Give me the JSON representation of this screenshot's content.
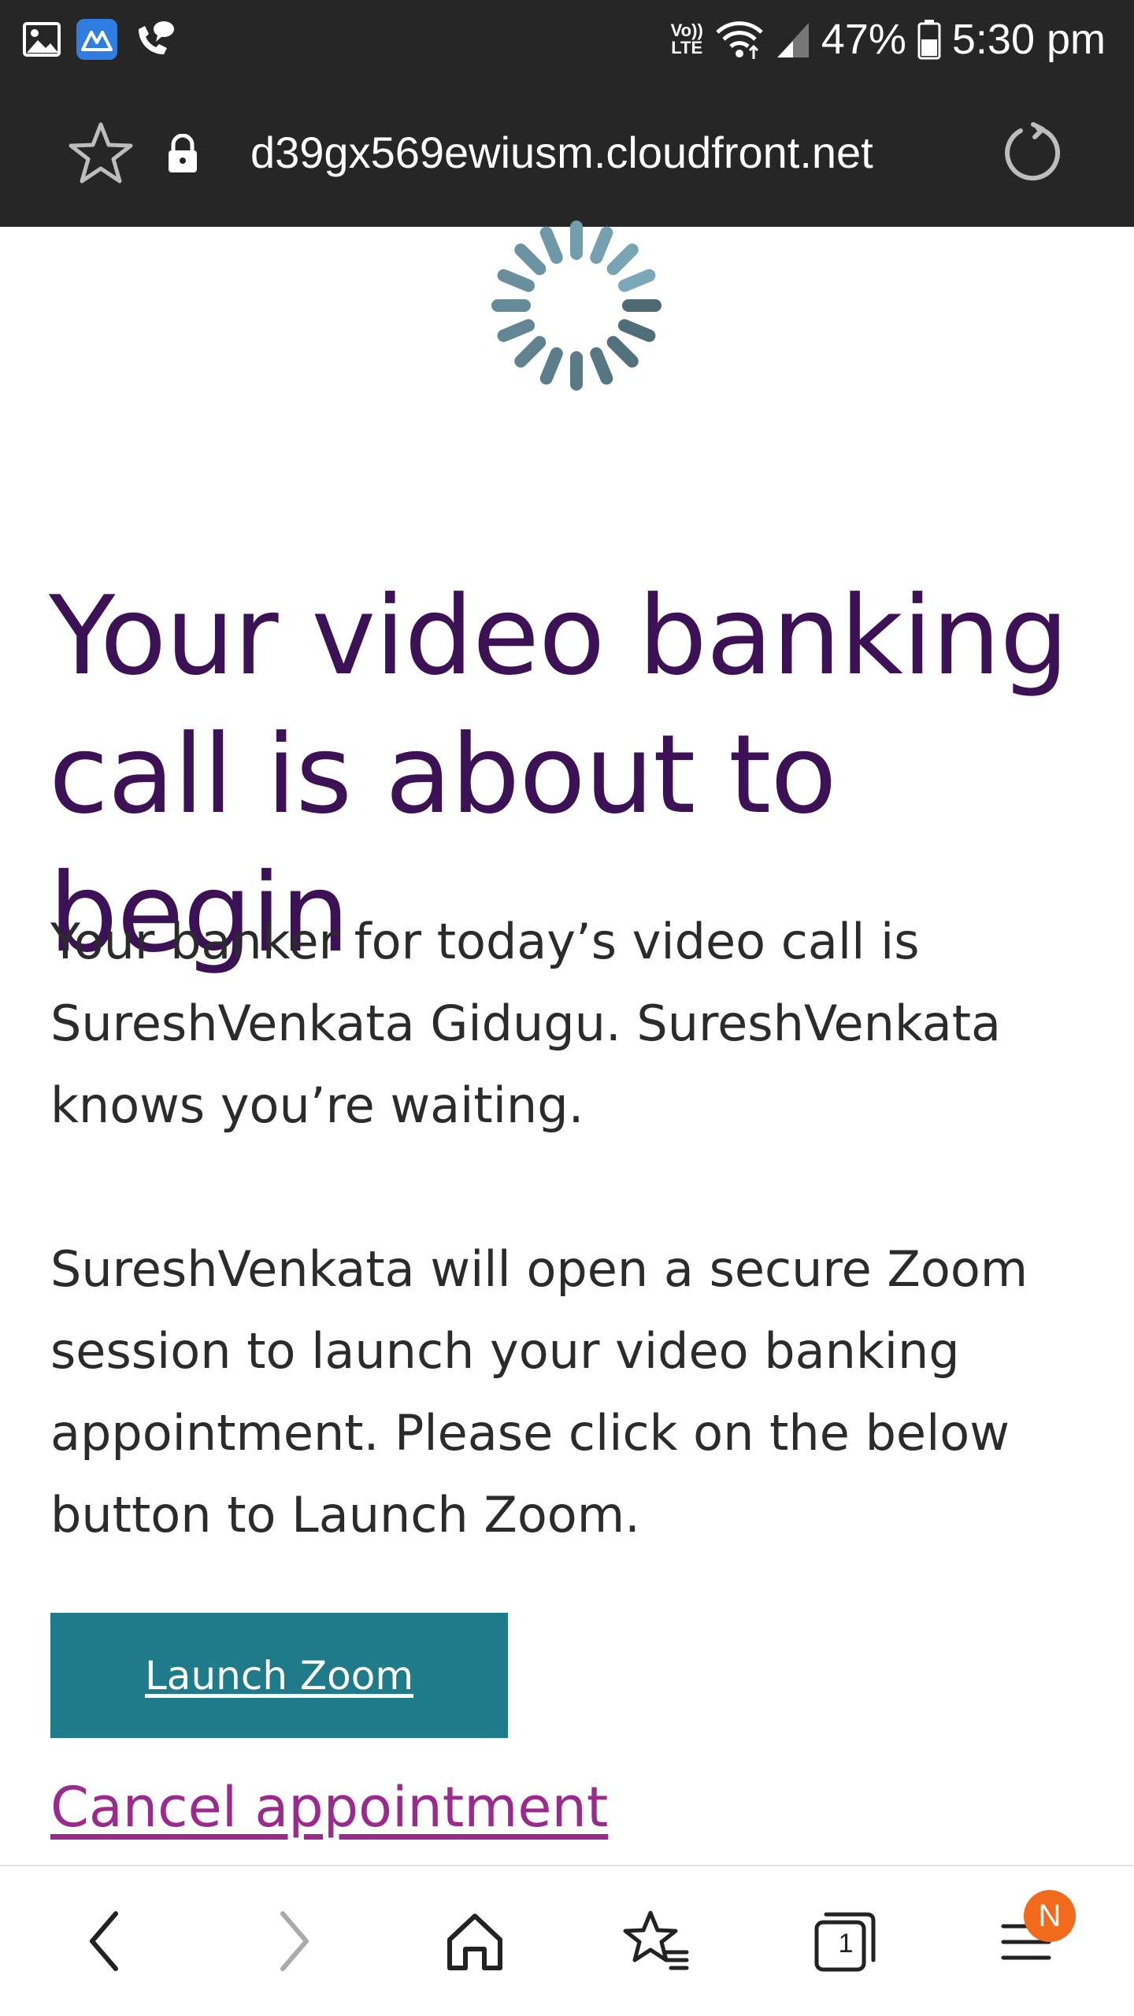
{
  "status_bar": {
    "left_icons": [
      "gallery-icon",
      "app-icon",
      "call-icon"
    ],
    "network_label": "VoLTE",
    "network_label_top": "Vo))",
    "network_label_bottom": "LTE",
    "battery_percent": "47%",
    "time": "5:30 pm"
  },
  "address_bar": {
    "url": "d39gx569ewiusm.cloudfront.net",
    "icons": [
      "star-icon",
      "lock-icon",
      "reload-icon"
    ]
  },
  "page": {
    "heading": "Your video banking call is about to begin",
    "paragraph_1": "Your banker for today’s video call is SureshVenkata Gidugu. SureshVenkata knows you’re waiting.",
    "paragraph_2": "SureshVenkata will open a secure Zoom session to launch your video banking appointment. Please click on the below button to Launch Zoom.",
    "launch_button": "Launch Zoom",
    "cancel_link": "Cancel appointment"
  },
  "bottom_nav": {
    "tabs_count": "1",
    "menu_badge": "N",
    "icons": [
      "back-icon",
      "forward-icon",
      "home-icon",
      "bookmarks-icon",
      "tabs-icon",
      "menu-icon"
    ]
  },
  "colors": {
    "heading": "#3d1155",
    "body_text": "#2b2b2b",
    "button_bg": "#1f7a8a",
    "cancel_link": "#9b2a8e",
    "bars_bg": "#262626",
    "badge": "#f26b1d"
  }
}
